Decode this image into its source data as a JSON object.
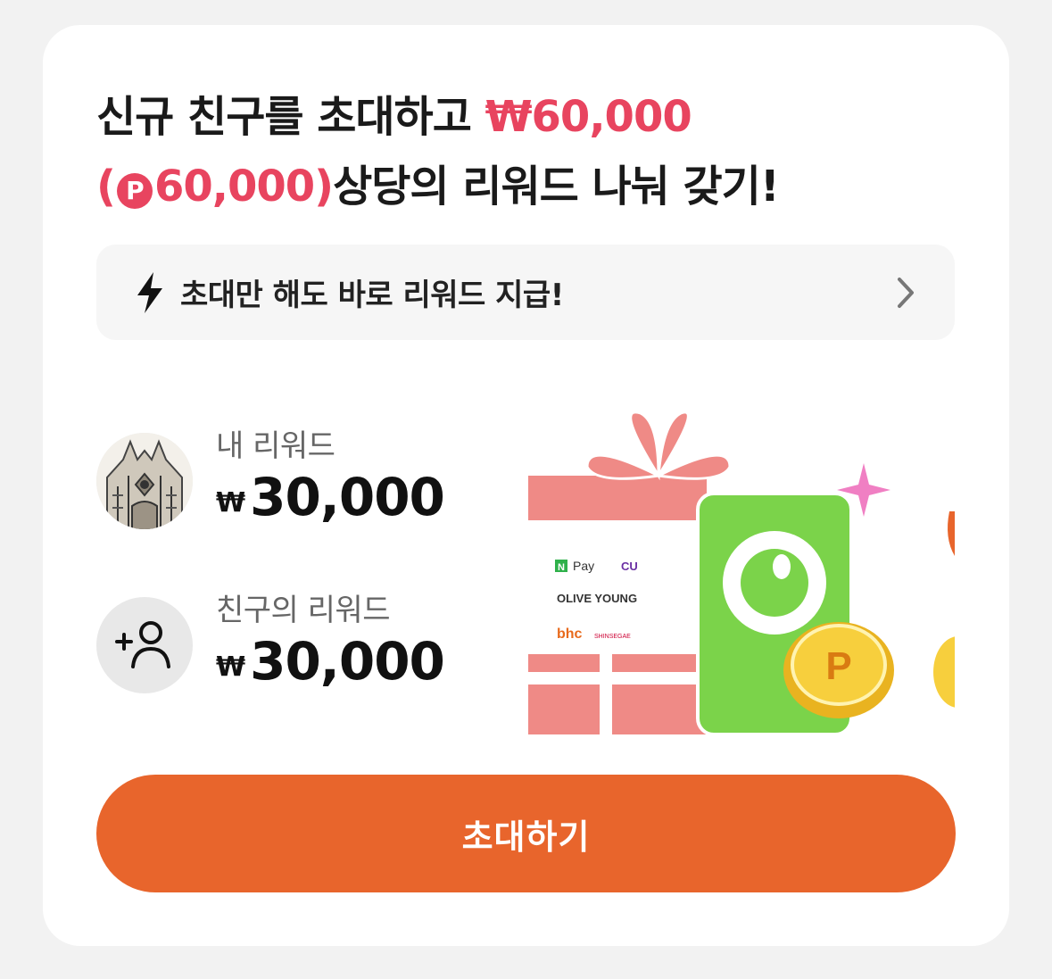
{
  "headline": {
    "line1_prefix": "신규 친구를 초대하고 ",
    "line1_accent": "₩60,000",
    "line2_accent_open": "(",
    "point_symbol": "P",
    "line2_accent_value": "60,000)",
    "line2_suffix": "상당의 리워드 나눠 갖기!"
  },
  "banner": {
    "icon": "lightning-icon",
    "text": "초대만 해도 바로 리워드 지급!",
    "chevron": "chevron-right-icon"
  },
  "rewards": {
    "mine": {
      "label": "내 리워드",
      "currency": "₩",
      "amount": "30,000"
    },
    "friend": {
      "label": "친구의 리워드",
      "currency": "₩",
      "amount": "30,000"
    }
  },
  "illustration": {
    "brands": [
      "Pay",
      "CU",
      "OLIVE YOUNG",
      "bhc",
      "SHINSEGAE"
    ],
    "npay_badge": "N",
    "coin_symbol": "P"
  },
  "cta": {
    "label": "초대하기"
  },
  "colors": {
    "accent": "#e8445f",
    "button": "#e8652c",
    "banner_bg": "#f6f6f6"
  }
}
